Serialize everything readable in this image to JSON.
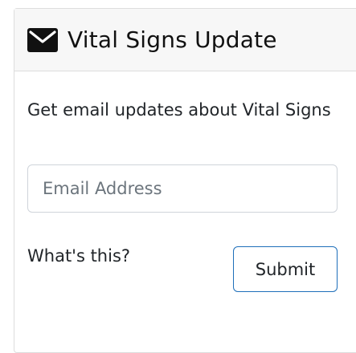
{
  "header": {
    "icon": "envelope-icon",
    "title": "Vital Signs Update"
  },
  "body": {
    "intro_text": "Get email updates about Vital Signs",
    "email_placeholder": "Email Address",
    "whats_this_label": "What's this?",
    "submit_label": "Submit"
  },
  "colors": {
    "header_bg": "#f7f7f7",
    "border": "#dddddd",
    "submit_border": "#1e6fba"
  }
}
